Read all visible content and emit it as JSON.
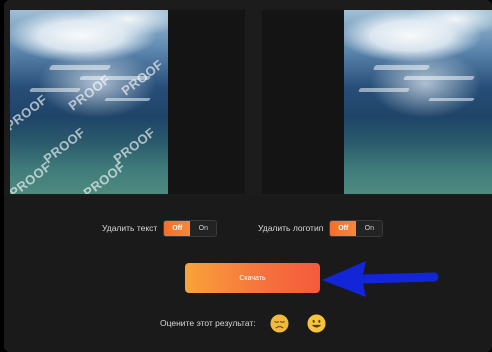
{
  "images": {
    "watermark_text": "PROOF"
  },
  "options": {
    "remove_text": {
      "label": "Удалить текст",
      "off_label": "Off",
      "on_label": "On",
      "state": "Off"
    },
    "remove_logo": {
      "label": "Удалить логотип",
      "off_label": "Off",
      "on_label": "On",
      "state": "Off"
    }
  },
  "actions": {
    "download_label": "Скачать"
  },
  "rating": {
    "prompt": "Оцените этот результат:",
    "options": [
      "sad-face-icon",
      "happy-face-icon"
    ]
  },
  "colors": {
    "accent_orange": "#f36e2a",
    "button_gradient_start": "#f8a33a",
    "button_gradient_end": "#f45a3b",
    "annotation_arrow": "#1226d8"
  }
}
